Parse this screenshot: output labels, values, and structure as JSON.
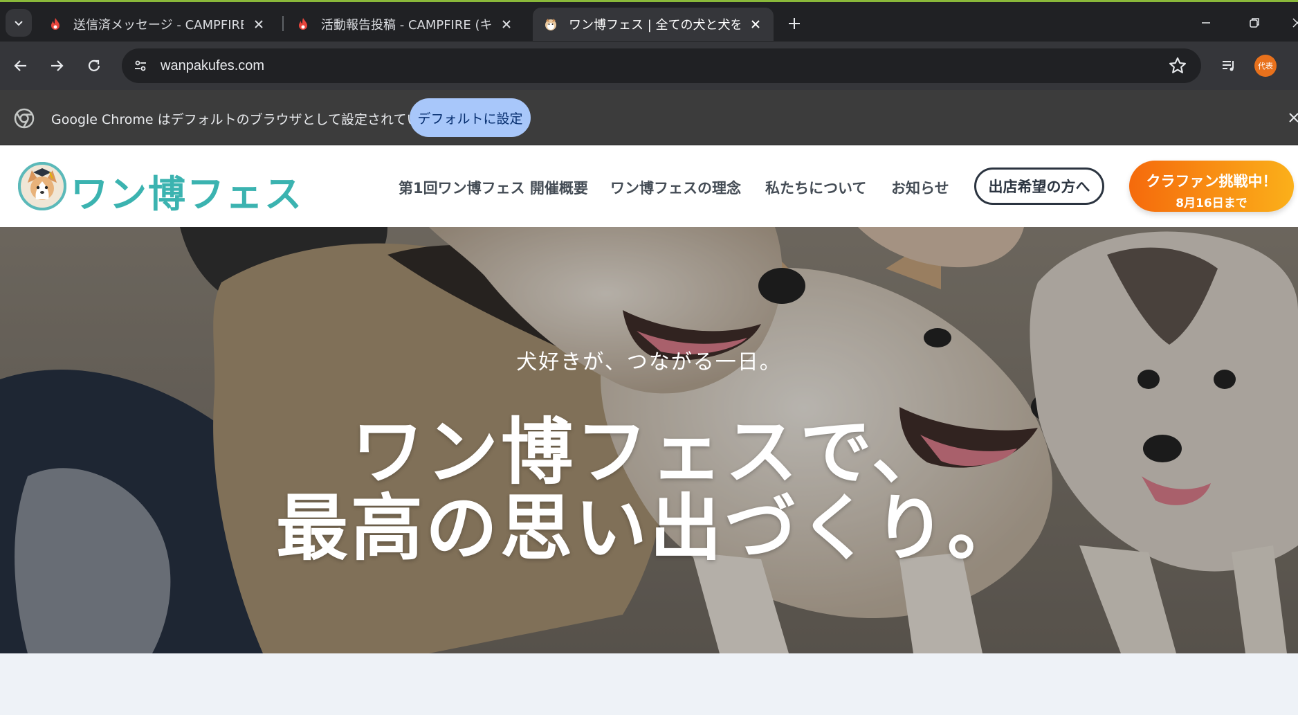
{
  "browser": {
    "tabs": [
      {
        "title": "送信済メッセージ - CAMPFIRE (キャ",
        "favicon": "campfire-flame-icon",
        "active": false
      },
      {
        "title": "活動報告投稿 - CAMPFIRE (キャン",
        "favicon": "campfire-flame-icon",
        "active": false
      },
      {
        "title": "ワン博フェス | 全ての犬と犬を愛する",
        "favicon": "corgi-icon",
        "active": true
      }
    ],
    "url": "wanpakufes.com",
    "profile_label": "代表",
    "infobar": {
      "message": "Google Chrome はデフォルトのブラウザとして設定されていません",
      "button": "デフォルトに設定"
    },
    "colors": {
      "accent_green": "#8ab93a",
      "flame": "#e8453c"
    }
  },
  "site": {
    "logo_text": "ワン博フェス",
    "nav": [
      "第1回ワン博フェス 開催概要",
      "ワン博フェスの理念",
      "私たちについて",
      "お知らせ"
    ],
    "exhibitor_button": "出店希望の方へ",
    "cta": {
      "line1": "クラファン挑戦中！",
      "line2": "8月16日まで"
    },
    "colors": {
      "brand_teal": "#3bb3b0",
      "cta_start": "#f56a0c",
      "cta_end": "#fbb01a"
    }
  },
  "hero": {
    "subtitle": "犬好きが、つながる一日。",
    "title_line1": "ワン博フェスで、",
    "title_line2": "最高の思い出づくり。"
  }
}
